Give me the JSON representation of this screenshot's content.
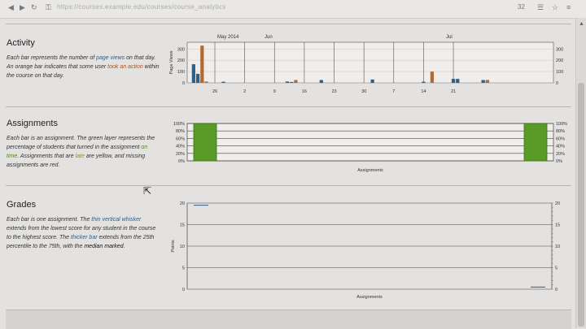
{
  "browser": {
    "url_text": "https://courses.example.edu/courses/course_analytics",
    "count_badge": "32"
  },
  "activity": {
    "title": "Activity",
    "desc": {
      "a": "Each bar represents the number of ",
      "b": "page views",
      "c": " on that day. An orange bar indicates that some user ",
      "d": "took an action",
      "e": " within the course on that day."
    },
    "chart_data": {
      "type": "bar",
      "ylabel": "Page Views",
      "ylim": [
        0,
        360
      ],
      "yticks": [
        "0",
        "100",
        "200",
        "300"
      ],
      "month_labels": [
        "May 2014",
        "Jun",
        "Jul"
      ],
      "xticks": [
        "26",
        "2",
        "9",
        "16",
        "23",
        "30",
        "7",
        "14",
        "21"
      ],
      "series": [
        {
          "color": "#2e5f86",
          "values": [
            0,
            165,
            80,
            30,
            0,
            0,
            0,
            0,
            10,
            0,
            0,
            0,
            0,
            0,
            0,
            0,
            0,
            0,
            0,
            0,
            0,
            0,
            0,
            12,
            8,
            0,
            0,
            0,
            0,
            0,
            0,
            25,
            0,
            0,
            0,
            0,
            0,
            0,
            0,
            0,
            0,
            0,
            0,
            30,
            0,
            0,
            0,
            0,
            0,
            0,
            0,
            0,
            0,
            0,
            0,
            10,
            0,
            0,
            0,
            0,
            0,
            0,
            35,
            35,
            0,
            0,
            0,
            0,
            0,
            25,
            25,
            0,
            0,
            0,
            0,
            0,
            0,
            0,
            0,
            0,
            0,
            0,
            0,
            0,
            0,
            0
          ]
        },
        {
          "color": "#b16a33",
          "values": [
            0,
            0,
            0,
            330,
            12,
            0,
            0,
            0,
            0,
            0,
            0,
            0,
            0,
            0,
            0,
            0,
            0,
            0,
            0,
            0,
            0,
            0,
            0,
            0,
            0,
            25,
            0,
            0,
            0,
            0,
            0,
            0,
            0,
            0,
            0,
            0,
            0,
            0,
            0,
            0,
            0,
            0,
            0,
            0,
            0,
            0,
            0,
            0,
            0,
            0,
            0,
            0,
            0,
            0,
            0,
            0,
            0,
            100,
            0,
            0,
            0,
            0,
            0,
            0,
            0,
            0,
            0,
            0,
            0,
            0,
            25,
            0,
            0,
            0,
            0,
            0,
            0,
            0,
            0,
            0,
            0,
            0,
            0,
            0,
            0,
            0
          ]
        }
      ]
    }
  },
  "assignments": {
    "title": "Assignments",
    "desc": {
      "a": "Each bar is an assignment. The green layer represents the percentage of students that turned in the assignment ",
      "b": "on time",
      "c": ". Assignments that are ",
      "d": "late",
      "e": " are yellow, and missing assignments are red."
    },
    "chart_data": {
      "type": "bar",
      "xlabel": "Assignments",
      "ylim": [
        0,
        100
      ],
      "yticks": [
        "0%",
        "20%",
        "40%",
        "60%",
        "80%",
        "100%"
      ],
      "bars": [
        {
          "on_time_pct": 100,
          "late_pct": 0,
          "missing_pct": 0
        },
        {
          "on_time_pct": 100,
          "late_pct": 0,
          "missing_pct": 0
        }
      ],
      "colors": {
        "on_time": "#5a9a27",
        "late": "#c9a915",
        "missing": "#b03a2e"
      }
    }
  },
  "grades": {
    "title": "Grades",
    "desc": {
      "a": "Each bar is one assignment. The ",
      "b": "thin vertical whisker",
      "c": " extends from the lowest score for any student in the course to the highest score. The ",
      "d": "thicker bar",
      "e": " extends from the 25th percentile to the 75th, with the ",
      "f": "median marked",
      "g": "."
    },
    "chart_data": {
      "type": "bar",
      "xlabel": "Assignments",
      "ylabel": "Points",
      "ylim": [
        0,
        20
      ],
      "yticks": [
        "0",
        "5",
        "10",
        "15",
        "20"
      ],
      "assignments": [
        {
          "min": 19.5,
          "q1": 19.5,
          "median": 19.5,
          "q3": 19.5,
          "max": 19.5
        },
        {
          "min": 0.5,
          "q1": 0.5,
          "median": 0.5,
          "q3": 0.5,
          "max": 0.5
        }
      ]
    }
  }
}
